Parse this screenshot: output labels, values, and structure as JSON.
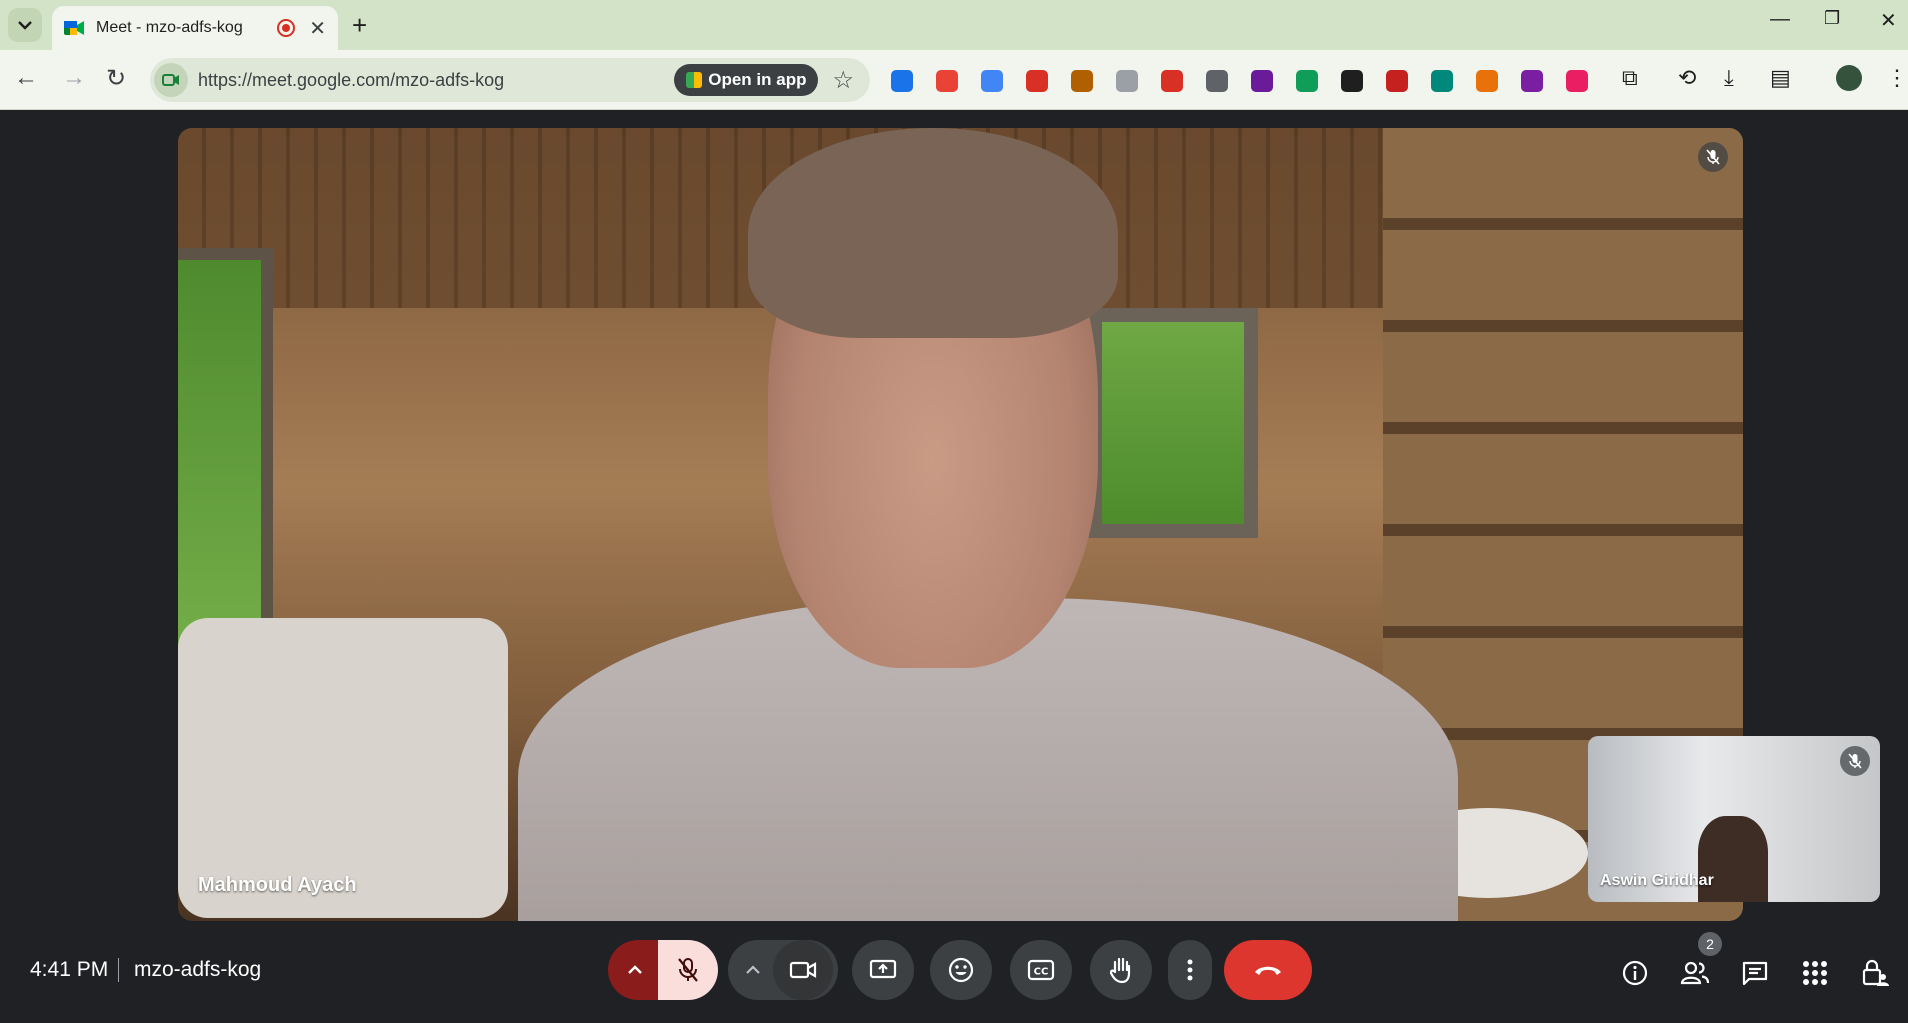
{
  "browser": {
    "tab_title": "Meet - mzo-adfs-kog",
    "url": "https://meet.google.com/mzo-adfs-kog",
    "open_in_app_label": "Open in app",
    "extension_colors": [
      "#1a73e8",
      "#e94335",
      "#4285f4",
      "#d93025",
      "#b06000",
      "#9aa0a6",
      "#d93025",
      "#5f6368",
      "#6a1b9a",
      "#0f9d58",
      "#1f1f1f",
      "#c5221f",
      "#00897b",
      "#e8710a",
      "#7b1fa2",
      "#e91e63"
    ]
  },
  "meeting": {
    "main_participant": "Mahmoud Ayach",
    "self_participant": "Aswin Giridhar",
    "clock": "4:41 PM",
    "code": "mzo-adfs-kog",
    "participant_count": "2"
  },
  "colors": {
    "end_call": "#dc362e",
    "mic_off_bg": "#f9dedc",
    "tabstrip": "#d3e3c8"
  }
}
